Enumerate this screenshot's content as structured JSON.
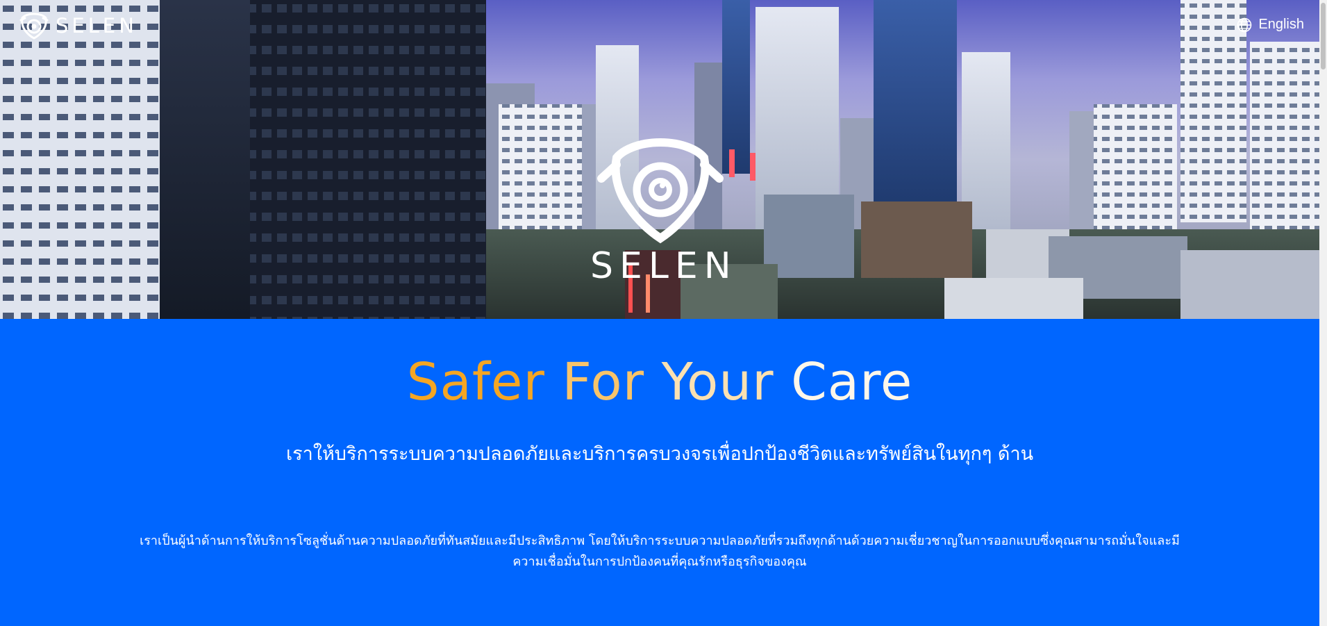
{
  "header": {
    "brand": "SELEN",
    "language_label": "English"
  },
  "hero": {
    "brand": "SELEN"
  },
  "intro": {
    "headline_words": [
      "Safer",
      "For",
      "Your",
      "Care"
    ],
    "tagline": "เราให้บริการระบบความปลอดภัยและบริการครบวงจรเพื่อปกป้องชีวิตและทรัพย์สินในทุกๆ ด้าน",
    "description": "เราเป็นผู้นำด้านการให้บริการโซลูชั่นด้านความปลอดภัยที่ทันสมัยและมีประสิทธิภาพ โดยให้บริการระบบความปลอดภัยที่รวมถึงทุกด้านด้วยความเชี่ยวชาญในการออกแบบซึ่งคุณสามารถมั่นใจและมีความเชื่อมั่นในการปกป้องคนที่คุณรักหรือธุรกิจของคุณ"
  },
  "colors": {
    "section_blue": "#0066ff",
    "headline_gradient": [
      "#f5a623",
      "#f8c46b",
      "#fbe1b2",
      "#fff7ea"
    ],
    "text": "#ffffff"
  },
  "icons": {
    "logo": "shield-eye-icon",
    "language": "globe-icon"
  }
}
